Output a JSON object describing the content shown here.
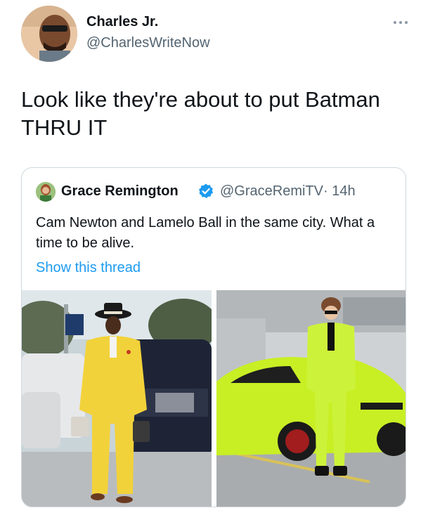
{
  "tweet": {
    "author_name": "Charles Jr.",
    "author_handle": "@CharlesWriteNow",
    "text": "Look like they're about to put Batman THRU IT"
  },
  "quoted_tweet": {
    "author_name": "Grace Remington",
    "author_handle": "@GraceRemiTV",
    "time": "· 14h",
    "text": "Cam Newton and Lamelo Ball in the same city. What a time to be alive.",
    "show_thread": "Show this thread",
    "verified": true
  },
  "colors": {
    "link": "#1d9bf0",
    "verified": "#1d9bf0",
    "suit_yellow": "#f2d23a",
    "suit_lime": "#cdf23a",
    "car_lime": "#c8ef24"
  },
  "icons": {
    "more": "more-horizontal-icon",
    "verified": "verified-badge-icon"
  }
}
